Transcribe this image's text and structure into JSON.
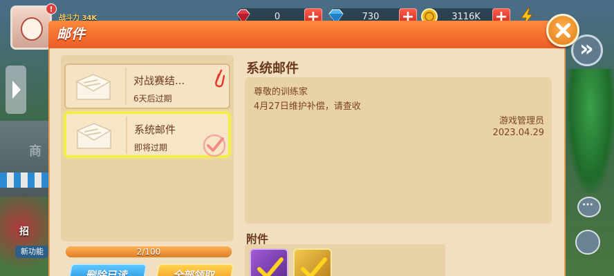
{
  "top_bar": {
    "avatar_badge": "!",
    "combat_power": "战斗力 34K",
    "resources": [
      {
        "name": "ruby",
        "icon": "red-gem-icon",
        "value": "0"
      },
      {
        "name": "diamond",
        "icon": "blue-diamond-icon",
        "value": "730"
      },
      {
        "name": "coin",
        "icon": "gold-coin-icon",
        "value": "3116K"
      },
      {
        "name": "energy",
        "icon": "lightning-icon",
        "value": ""
      }
    ],
    "plus_label": "+"
  },
  "background": {
    "shop_text": "商",
    "recruit_text": "招",
    "new_func_text": "新功能"
  },
  "modal": {
    "title": "邮件",
    "mail_list": [
      {
        "title": "对战赛结...",
        "subtitle": "6天后过期",
        "has_attachment": true,
        "selected": false,
        "read": false
      },
      {
        "title": "系统邮件",
        "subtitle": "即将过期",
        "has_attachment": false,
        "selected": true,
        "read": true
      }
    ],
    "capacity": {
      "text": "2/100",
      "used": 2,
      "max": 100
    },
    "buttons": {
      "delete_read": "删除已读",
      "claim_all": "全部领取"
    },
    "detail": {
      "title": "系统邮件",
      "greeting": "尊敬的训练家",
      "content": "4月27日维护补偿，请查收",
      "sender": "游戏管理员",
      "date": "2023.04.29",
      "attachments_label": "附件",
      "attachments": [
        {
          "kind": "purple-item",
          "claimed": true
        },
        {
          "kind": "gold-item",
          "claimed": true
        }
      ]
    }
  },
  "colors": {
    "header": "#ec5b25",
    "panel": "#f1dfbf",
    "text_brown": "#6b3a1e",
    "highlight": "#f2f13a"
  }
}
